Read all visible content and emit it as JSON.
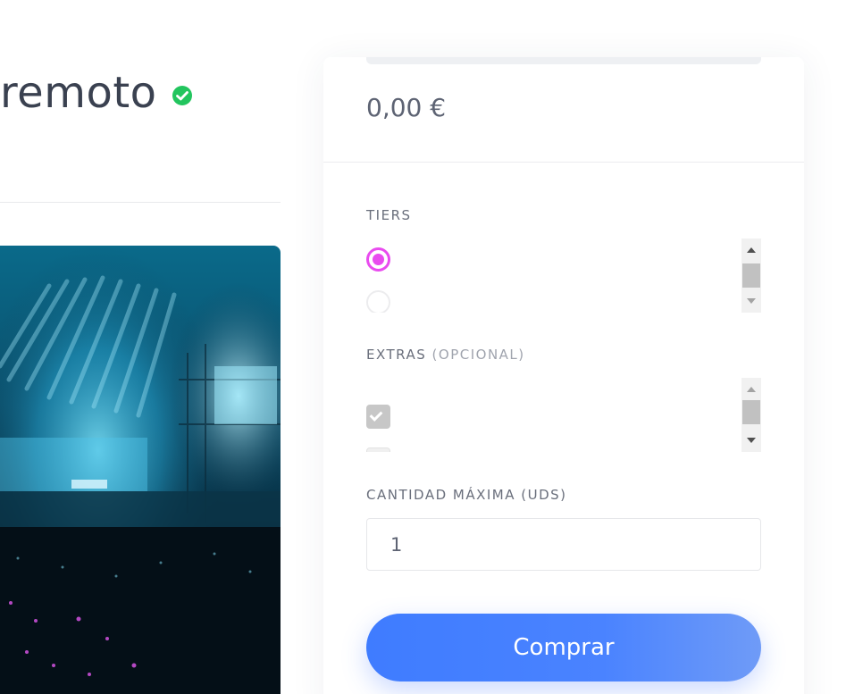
{
  "product": {
    "title": "remoto",
    "verified_icon": "check-circle-icon",
    "verified_color": "#22c55e"
  },
  "hero_image": {
    "description_icon": "concert-stage-image"
  },
  "card": {
    "price": "0,00 €",
    "tiers": {
      "label": "TIERS",
      "options": [
        {
          "selected": true
        },
        {
          "selected": false
        }
      ],
      "accent_color": "#e94bef"
    },
    "extras": {
      "label": "EXTRAS",
      "label_suffix": "(OPCIONAL)",
      "options": [
        {
          "checked": true
        },
        {
          "checked": false
        }
      ]
    },
    "quantity": {
      "label": "CANTIDAD MÁXIMA (UDS)",
      "value": "1"
    },
    "buy_button": {
      "label": "Comprar",
      "color": "#3f7cff"
    }
  }
}
